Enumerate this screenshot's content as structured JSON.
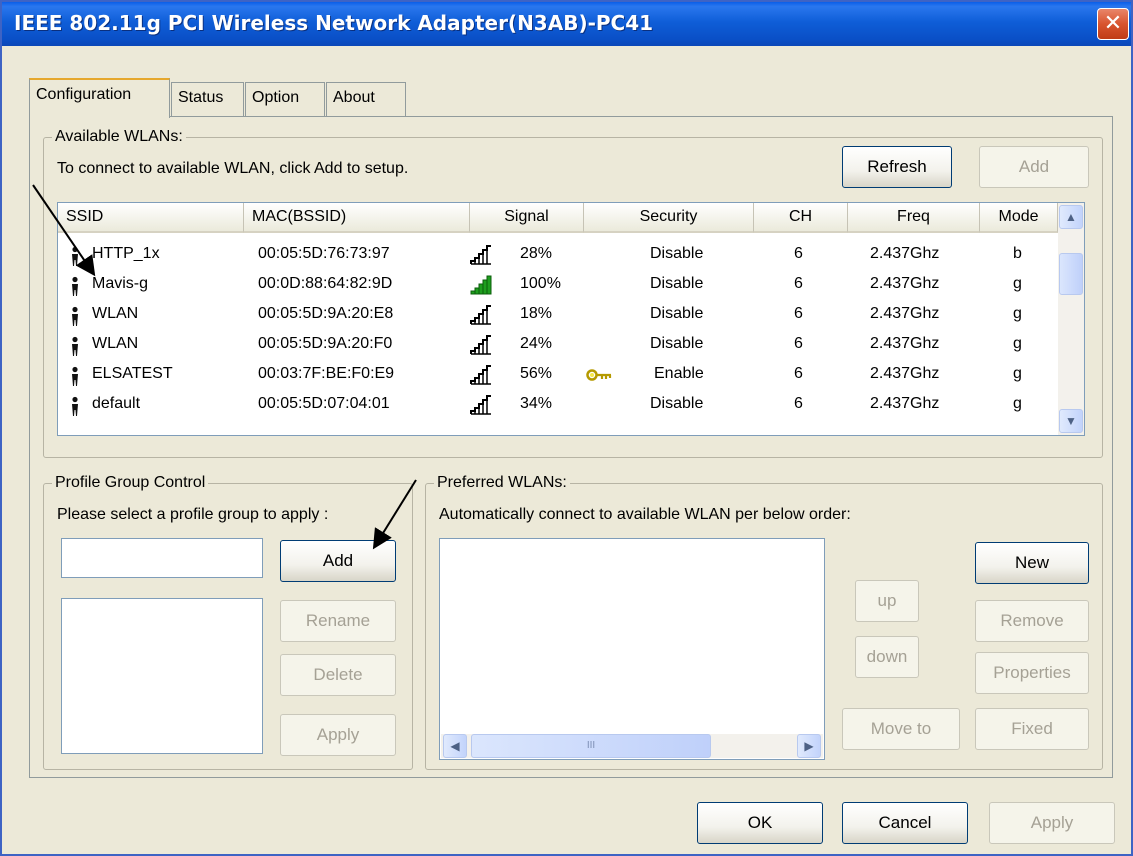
{
  "window": {
    "title": "IEEE 802.11g PCI Wireless Network Adapter(N3AB)-PC41",
    "close_glyph": "✕"
  },
  "tabs": [
    {
      "label": "Configuration",
      "active": true
    },
    {
      "label": "Status",
      "active": false
    },
    {
      "label": "Option",
      "active": false
    },
    {
      "label": "About",
      "active": false
    }
  ],
  "available": {
    "legend": "Available WLANs:",
    "hint": "To connect to available WLAN, click Add to setup.",
    "refresh_label": "Refresh",
    "add_label": "Add",
    "columns": [
      "SSID",
      "MAC(BSSID)",
      "Signal",
      "Security",
      "CH",
      "Freq",
      "Mode"
    ],
    "rows": [
      {
        "ssid": "HTTP_1x",
        "mac": "00:05:5D:76:73:97",
        "signal": "28%",
        "security": "Disable",
        "ch": "6",
        "freq": "2.437Ghz",
        "mode": "b",
        "encrypted": false,
        "strong": false
      },
      {
        "ssid": "Mavis-g",
        "mac": "00:0D:88:64:82:9D",
        "signal": "100%",
        "security": "Disable",
        "ch": "6",
        "freq": "2.437Ghz",
        "mode": "g",
        "encrypted": false,
        "strong": true
      },
      {
        "ssid": "WLAN",
        "mac": "00:05:5D:9A:20:E8",
        "signal": "18%",
        "security": "Disable",
        "ch": "6",
        "freq": "2.437Ghz",
        "mode": "g",
        "encrypted": false,
        "strong": false
      },
      {
        "ssid": "WLAN",
        "mac": "00:05:5D:9A:20:F0",
        "signal": "24%",
        "security": "Disable",
        "ch": "6",
        "freq": "2.437Ghz",
        "mode": "g",
        "encrypted": false,
        "strong": false
      },
      {
        "ssid": "ELSATEST",
        "mac": "00:03:7F:BE:F0:E9",
        "signal": "56%",
        "security": "Enable",
        "ch": "6",
        "freq": "2.437Ghz",
        "mode": "g",
        "encrypted": true,
        "strong": false
      },
      {
        "ssid": "default",
        "mac": "00:05:5D:07:04:01",
        "signal": "34%",
        "security": "Disable",
        "ch": "6",
        "freq": "2.437Ghz",
        "mode": "g",
        "encrypted": false,
        "strong": false
      }
    ]
  },
  "profile_group": {
    "legend": "Profile Group Control",
    "hint": "Please select a profile group to apply :",
    "name_value": "",
    "add_label": "Add",
    "rename_label": "Rename",
    "delete_label": "Delete",
    "apply_label": "Apply"
  },
  "preferred": {
    "legend": "Preferred WLANs:",
    "hint": "Automatically connect to available WLAN per below order:",
    "up_label": "up",
    "down_label": "down",
    "move_to_label": "Move to",
    "new_label": "New",
    "remove_label": "Remove",
    "properties_label": "Properties",
    "fixed_label": "Fixed",
    "scroll_grip": "III"
  },
  "footer": {
    "ok_label": "OK",
    "cancel_label": "Cancel",
    "apply_label": "Apply"
  },
  "colors": {
    "titlebar": "#0a5ee8",
    "face": "#ece9d8",
    "signal_strong": "#1e9e1e",
    "key": "#d8c400"
  }
}
